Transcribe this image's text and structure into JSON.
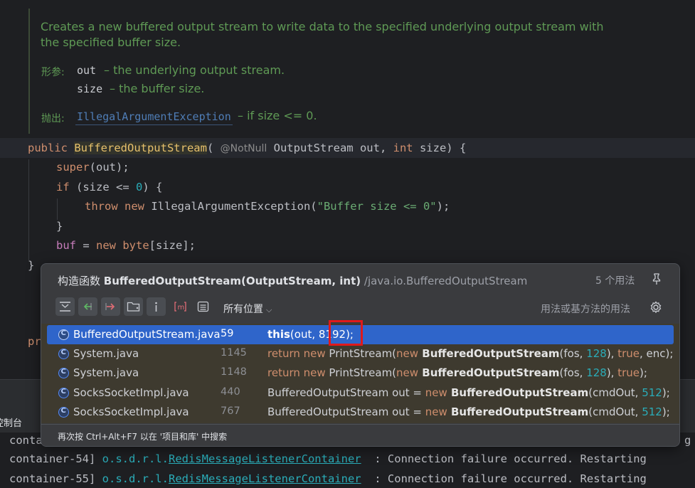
{
  "javadoc": {
    "line1": "Creates a new buffered output stream to write data to the specified underlying output stream with",
    "line2": "the specified buffer size.",
    "params_label": "形参:",
    "param1_name": "out",
    "param1_desc": "– the underlying output stream.",
    "param2_name": "size",
    "param2_desc": "– the buffer size.",
    "throws_label": "抛出:",
    "throws_type": "IllegalArgumentException",
    "throws_desc": "– if size <= 0."
  },
  "code": {
    "l1_public": "public ",
    "l1_name": "BufferedOutputStream",
    "l1_paren": "(",
    "l1_ann": "@NotNull",
    "l1_rest1": " OutputStream out, ",
    "l1_int": "int",
    "l1_rest2": " size) {",
    "l2_super": "super",
    "l2_rest": "(out);",
    "l3_if": "if",
    "l3_a": " (size <= ",
    "l3_zero": "0",
    "l3_b": ") {",
    "l4_throw": "throw",
    "l4_new": " new",
    "l4_a": " IllegalArgumentException(",
    "l4_str": "\"Buffer size <= 0\"",
    "l4_b": ");",
    "l5_close": "}",
    "l6_buf": "buf",
    "l6_eq": " = ",
    "l6_new": "new",
    "l6_byte": " byte",
    "l6_rest": "[size];",
    "l7_close": "}",
    "peek_line": "pr"
  },
  "popup": {
    "title_prefix": "构造函数 ",
    "title_sig": "BufferedOutputStream(OutputStream, int)",
    "title_path": " /java.io.BufferedOutputStream",
    "usage_count": "5 个用法",
    "scope": "所有位置",
    "usages_label": "用法或基方法的用法",
    "footer": "再次按 Ctrl+Alt+F7 以在 '项目和库' 中搜索",
    "icons": [
      "merge-icon",
      "read-access-icon",
      "write-access-icon",
      "folder-filter-icon",
      "info-icon",
      "method-icon",
      "preview-icon",
      "pin-icon",
      "gear-icon"
    ],
    "rows": [
      {
        "file": "BufferedOutputStream.java",
        "line": "59"
      },
      {
        "file": "System.java",
        "line": "1145"
      },
      {
        "file": "System.java",
        "line": "1148"
      },
      {
        "file": "SocksSocketImpl.java",
        "line": "440"
      },
      {
        "file": "SocksSocketImpl.java",
        "line": "767"
      }
    ],
    "row_code": {
      "r0_this": "this",
      "r0_a": "(out, ",
      "r0_num": "8192",
      "r0_b": ");",
      "r1_ret": "return new",
      "r1_a": " PrintStream(",
      "r1_new": "new",
      "r1_cls": " BufferedOutputStream",
      "r1_b": "(fos, ",
      "r1_num": "128",
      "r1_c": "), ",
      "r1_true": "true",
      "r1_d": ", enc);",
      "r2_ret": "return new",
      "r2_a": " PrintStream(",
      "r2_new": "new",
      "r2_cls": " BufferedOutputStream",
      "r2_b": "(fos, ",
      "r2_num": "128",
      "r2_c": "), ",
      "r2_true": "true",
      "r2_d": ");",
      "r3_a": "BufferedOutputStream out = ",
      "r3_new": "new",
      "r3_cls": " BufferedOutputStream",
      "r3_b": "(cmdOut, ",
      "r3_num": "512",
      "r3_c": ");",
      "r4_a": "BufferedOutputStream out = ",
      "r4_new": "new",
      "r4_cls": " BufferedOutputStream",
      "r4_b": "(cmdOut, ",
      "r4_num": "512",
      "r4_c": ");"
    }
  },
  "console": {
    "tab_label": "控制台",
    "line0": "conta",
    "line0_tail": "g",
    "line1_prefix": "container-54] ",
    "line1_pkg": "o.s.d.r.l.",
    "line1_cls": "RedisMessageListenerContainer",
    "line1_msg": "  : Connection failure occurred. Restarting",
    "line2_prefix": "container-55] ",
    "line2_pkg": "o.s.d.r.l.",
    "line2_cls": "RedisMessageListenerContainer",
    "line2_msg": "  : Connection failure occurred. Restarting"
  }
}
